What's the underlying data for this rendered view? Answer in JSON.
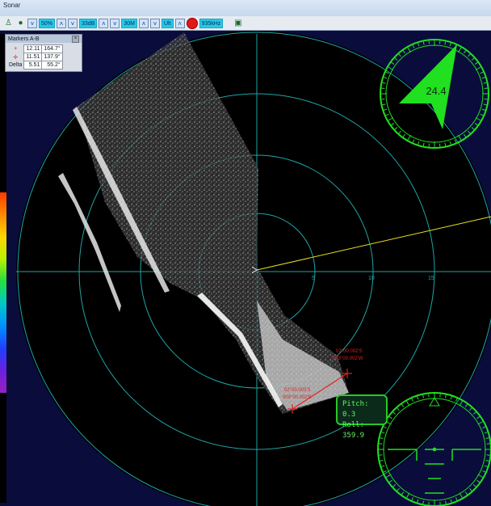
{
  "window": {
    "title": "Sonar"
  },
  "toolbar": {
    "gain": "50%",
    "range_db": "33dB",
    "range": "30M",
    "mode": "Ult",
    "frequency": "935kHz"
  },
  "markers_panel": {
    "title": "Markers A-B",
    "rows": [
      {
        "label": "",
        "icon": "+",
        "range": "12.11",
        "bearing": "164.7°"
      },
      {
        "label": "",
        "icon": "✛",
        "range": "11.51",
        "bearing": "137.9°"
      },
      {
        "label": "Delta",
        "icon": "",
        "range": "5.51",
        "bearing": "55.2°"
      }
    ]
  },
  "compass": {
    "heading": "24.4"
  },
  "attitude": {
    "pitch": "Pitch: 0.3",
    "roll": "Roll: 359.9"
  },
  "range_labels": [
    "5",
    "10",
    "15"
  ],
  "marker_coords": {
    "a_lat": "02°00.002'S",
    "a_lon": "003°00.002'W",
    "b_lat": "02°00.003'S",
    "b_lon": "003°00.002'E"
  },
  "colors": {
    "ring": "#1fa5a5",
    "compass": "#20e020",
    "marker": "#e02020",
    "heading_line": "#e8e020"
  }
}
